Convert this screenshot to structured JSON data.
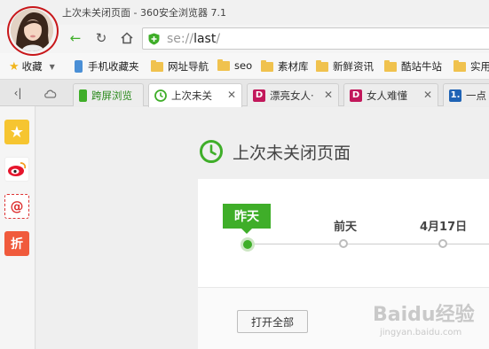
{
  "window": {
    "title": "上次未关闭页面 - 360安全浏览器 7.1"
  },
  "address_bar": {
    "scheme": "se://",
    "host": "last",
    "suffix": "/"
  },
  "bookmarks": [
    {
      "label": "收藏",
      "icon": "star-icon"
    },
    {
      "label": "手机收藏夹",
      "icon": "phone-icon"
    },
    {
      "label": "网址导航",
      "icon": "folder-icon"
    },
    {
      "label": "seo",
      "icon": "folder-icon"
    },
    {
      "label": "素材库",
      "icon": "folder-icon"
    },
    {
      "label": "新鲜资讯",
      "icon": "folder-icon"
    },
    {
      "label": "酷站牛站",
      "icon": "folder-icon"
    },
    {
      "label": "实用",
      "icon": "folder-icon"
    }
  ],
  "tabs": [
    {
      "label": "跨屏浏览",
      "icon": "phone-icon",
      "color": "#3fae29"
    },
    {
      "label": "上次未关",
      "icon": "clock-icon",
      "active": true
    },
    {
      "label": "漂亮女人·",
      "icon": "d-logo-icon",
      "color": "#c2185b"
    },
    {
      "label": "女人难懂",
      "icon": "d-logo-icon",
      "color": "#c2185b"
    },
    {
      "label": "一点",
      "icon": "one-icon",
      "color": "#1f63b5"
    }
  ],
  "page": {
    "title": "上次未关闭页面",
    "timeline": [
      "昨天",
      "前天",
      "4月17日"
    ],
    "open_all": "打开全部"
  },
  "watermark": {
    "text": "Baidu经验",
    "sub": "jingyan.baidu.com"
  },
  "colors": {
    "accent": "#3fae29",
    "ring": "#c8171a"
  }
}
